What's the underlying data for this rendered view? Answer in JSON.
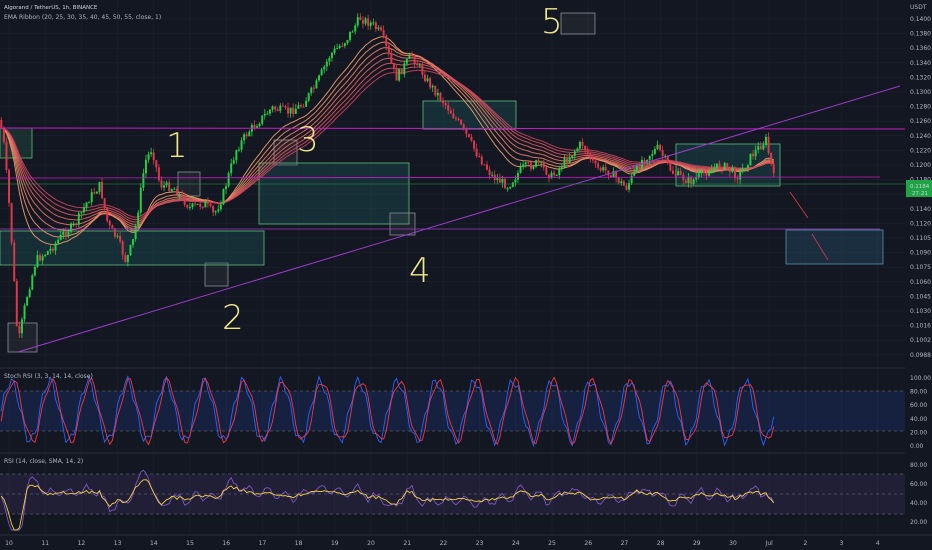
{
  "header": {
    "symbol_line": "Algorand / TetherUS, 1h, BINANCE",
    "indicator_line": "EMA Ribbon (20, 25, 30, 35, 40, 45, 50, 55, close, 1)"
  },
  "price_axis": {
    "currency": "USDT",
    "ticks": [
      "0.1400",
      "0.1380",
      "0.1360",
      "0.1340",
      "0.1320",
      "0.1300",
      "0.1280",
      "0.1260",
      "0.1240",
      "0.1220",
      "0.1200",
      "0.1180",
      "0.1160",
      "0.1140",
      "0.1120",
      "0.1105",
      "0.1090",
      "0.1075",
      "0.1060",
      "0.1045",
      "0.1030",
      "0.1016",
      "0.1002",
      "0.0988"
    ],
    "current_price": "0.1184",
    "current_sub": "27:21"
  },
  "time_axis": {
    "ticks": [
      "10",
      "11",
      "12",
      "13",
      "14",
      "15",
      "16",
      "17",
      "18",
      "19",
      "20",
      "21",
      "22",
      "23",
      "24",
      "25",
      "26",
      "27",
      "28",
      "29",
      "30",
      "Jul",
      "2",
      "3",
      "4"
    ]
  },
  "stoch": {
    "title": "Stoch RSI (3, 3, 14, 14, close)",
    "ticks": [
      "100.00",
      "80.00",
      "60.00",
      "40.00",
      "20.00",
      "0.00"
    ]
  },
  "rsi": {
    "title": "RSI (14, close, SMA, 14, 2)",
    "ticks": [
      "80.00",
      "60.00",
      "40.00",
      "20.00"
    ]
  },
  "annotations": {
    "wave_1": "1",
    "wave_2": "2",
    "wave_3": "3",
    "wave_4": "4",
    "wave_5": "5"
  },
  "colors": {
    "background": "#131722",
    "candle_up": "#26d043",
    "candle_down": "#e0384b",
    "ribbon": "#e8735a",
    "magenta": "#c51ec5",
    "box_border": "#5bbd7a",
    "box_fill": "#1e5a5a",
    "stoch_k": "#2962ff",
    "stoch_d": "#f23645",
    "rsi_line": "#7e57c2",
    "rsi_ma": "#f5d142",
    "annotation": "#f0e68c",
    "price_label": "#1fa347"
  }
}
